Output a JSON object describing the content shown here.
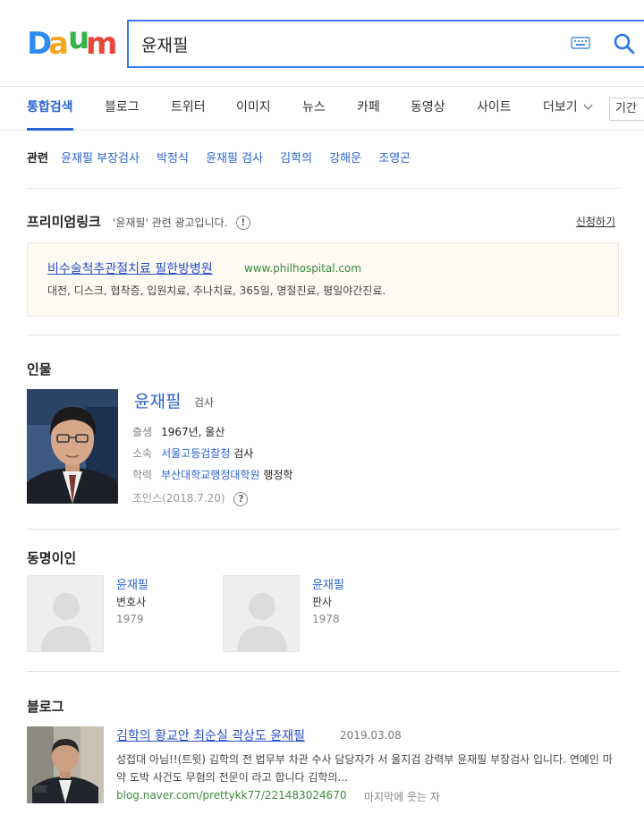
{
  "brand": {
    "logo_letters": [
      "D",
      "a",
      "u",
      "m"
    ],
    "logo_colors": [
      "#2d8cf0",
      "#f6a623",
      "#35b34a",
      "#e8463c"
    ]
  },
  "search": {
    "query": "윤재필",
    "keyboard_icon": "keyboard-icon",
    "search_icon": "search-icon"
  },
  "tabs": [
    {
      "label": "통합검색",
      "active": true
    },
    {
      "label": "블로그"
    },
    {
      "label": "트위터"
    },
    {
      "label": "이미지"
    },
    {
      "label": "뉴스"
    },
    {
      "label": "카페"
    },
    {
      "label": "동영상"
    },
    {
      "label": "사이트"
    },
    {
      "label": "더보기"
    }
  ],
  "period_label": "기간",
  "related": {
    "title": "관련",
    "links": [
      "윤재필 부장검사",
      "박정식",
      "윤재필 검사",
      "김학의",
      "강해운",
      "조영곤"
    ]
  },
  "premium": {
    "title": "프리미엄링크",
    "note": "'윤재필' 관련 광고입니다.",
    "info_icon": "!",
    "apply_label": "신청하기",
    "ad": {
      "title": "비수술척추관절치료 필한방병원",
      "url": "www.philhospital.com",
      "desc": "대전, 디스크, 협착증, 입원치료, 추나치료, 365일, 명절진료, 평일야간진료."
    }
  },
  "person": {
    "section_title": "인물",
    "name": "윤재필",
    "role": "검사",
    "birth_label": "출생",
    "birth_value": "1967년, 울산",
    "affil_label": "소속",
    "affil_link": "서울고등검찰청",
    "affil_suffix": "검사",
    "edu_label": "학력",
    "edu_link": "부산대학교행정대학원",
    "edu_suffix": "행정학",
    "source": "조인스(2018.7.20)",
    "help_icon": "?"
  },
  "homonyms": {
    "section_title": "동명이인",
    "items": [
      {
        "name": "윤재필",
        "job": "변호사",
        "year": "1979"
      },
      {
        "name": "윤재필",
        "job": "판사",
        "year": "1978"
      }
    ]
  },
  "blog": {
    "section_title": "블로그",
    "title": "김학의 황교안 최순실 곽상도 윤재필",
    "date": "2019.03.08",
    "snippet": "성접대 아님!!(트윗) 김학의 전 법무부 차관 수사 담당자가 서 울지검 강력부 윤재필 부장검사 입니다. 연예인 마약 도박 사건도 무혐의 전문이 라고 합니다 김학의...",
    "url": "blog.naver.com/prettykk77/221483024670",
    "author": "마지막에 웃는 자"
  }
}
